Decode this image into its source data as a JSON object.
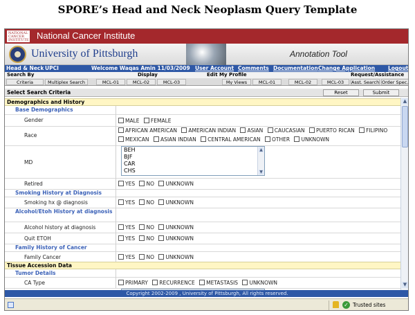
{
  "page_title": "SPORE’s Head and Neck Neoplasm Query Template",
  "header": {
    "nci_logo_text": "NATIONAL CANCER INSTITUTE",
    "nci_name": "National Cancer Institute",
    "university": "University of Pittsburgh",
    "tool_name": "Annotation Tool"
  },
  "topbar": {
    "project": "Head & Neck",
    "org": "UPCI",
    "welcome": "Welcome Waqas Amin 11/03/2009",
    "links": [
      "User Account",
      "Comments",
      "Documentation",
      "Change Application",
      "Logout"
    ]
  },
  "menu": {
    "search_by": "Search By",
    "display": "Display",
    "edit_profile": "Edit My Profile",
    "request": "Request/Assistance",
    "buttons": [
      "Criteria",
      "Multiplex Search",
      "MCL-01",
      "MCL-02",
      "MCL-03",
      "My Views",
      "MCL-01",
      "MCL-02",
      "MCL-03",
      "Asst. Search",
      "Order Spec."
    ]
  },
  "criteria": {
    "title": "Select Search Criteria",
    "reset": "Reset",
    "submit": "Submit"
  },
  "form": {
    "sec_demographics": "Demographics and History",
    "sub_base": "Base Demographics",
    "gender_label": "Gender",
    "gender_options": [
      "MALE",
      "FEMALE"
    ],
    "race_label": "Race",
    "race_options_line1": [
      "AFRICAN AMERICAN",
      "AMERICAN INDIAN",
      "ASIAN",
      "CAUCASIAN",
      "PUERTO RICAN",
      "FILIPINO"
    ],
    "race_options_line2": [
      "MEXICAN",
      "ASIAN INDIAN",
      "CENTRAL AMERICAN",
      "OTHER",
      "UNKNOWN"
    ],
    "md_label": "MD",
    "md_options": [
      "BEH",
      "BJF",
      "CAR",
      "CHS"
    ],
    "retired_label": "Retired",
    "yes_no_unknown": [
      "YES",
      "NO",
      "UNKNOWN"
    ],
    "sub_smoking": "Smoking History at Diagnosis",
    "smoking_label": "Smoking hx @ diagnosis",
    "sub_alcohol": "Alcohol/Etoh History at diagnosis",
    "alcohol_label": "Alcohol history at diagnosis",
    "quit_label": "Quit ETOH",
    "sub_family": "Family History of Cancer",
    "family_label": "Family Cancer",
    "sec_tissue": "Tissue Accession Data",
    "sub_tumor": "Tumor Details",
    "ca_type_label": "CA Type",
    "ca_type_options": [
      "PRIMARY",
      "RECURRENCE",
      "METASTASIS",
      "UNKNOWN"
    ]
  },
  "footer": {
    "copyright": "Copyright 2002-2009 , University of Pittsburgh, All rights reserved."
  },
  "status": {
    "zone": "Trusted sites"
  }
}
